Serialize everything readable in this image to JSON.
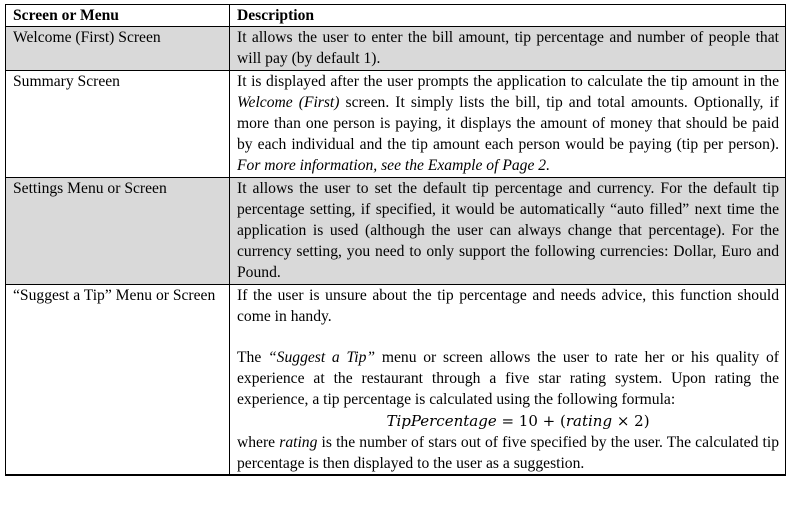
{
  "header": {
    "col1": "Screen or Menu",
    "col2": "Description"
  },
  "rows": [
    {
      "name": "Welcome (First) Screen",
      "description": "It allows the user to enter the bill amount, tip percentage and number of people that will pay (by default 1)."
    },
    {
      "name": "Summary Screen",
      "description_parts": {
        "before": "It is displayed after the user prompts the application to calculate the tip amount in the ",
        "italic": "Welcome (First)",
        "after": " screen. It simply lists the bill, tip and total amounts. Optionally, if more than one person is paying, it displays the amount of money that should be paid by each individual and the tip amount each person would be paying (tip per person). ",
        "italic_note": "For more information, see the Example of Page 2."
      }
    },
    {
      "name": "Settings Menu or Screen",
      "description": "It allows the user to set the default tip percentage and currency. For the default tip percentage setting, if specified, it would be automatically “auto filled” next time the application is used (although the user can always change that percentage). For the currency setting, you need to only support the following currencies: Dollar, Euro and Pound."
    },
    {
      "name": "“Suggest a Tip” Menu or Screen",
      "para1": "If the user is unsure about the tip percentage and needs advice, this function should come in handy.",
      "para2_before": "The ",
      "para2_italic": "“Suggest a Tip”",
      "para2_after": " menu or screen allows the user to rate her or his quality of experience at the restaurant through a five star rating system. Upon rating the experience, a tip percentage is calculated using the following formula:",
      "formula_lhs": "TipPercentage",
      "formula_eq": " = 10 + (",
      "formula_var": "rating",
      "formula_rest": " × 2)",
      "para3_before": "where ",
      "para3_italic": "rating",
      "para3_after": " is the number of stars out of five specified by the user. The calculated tip percentage is then displayed to the user as a suggestion."
    }
  ]
}
